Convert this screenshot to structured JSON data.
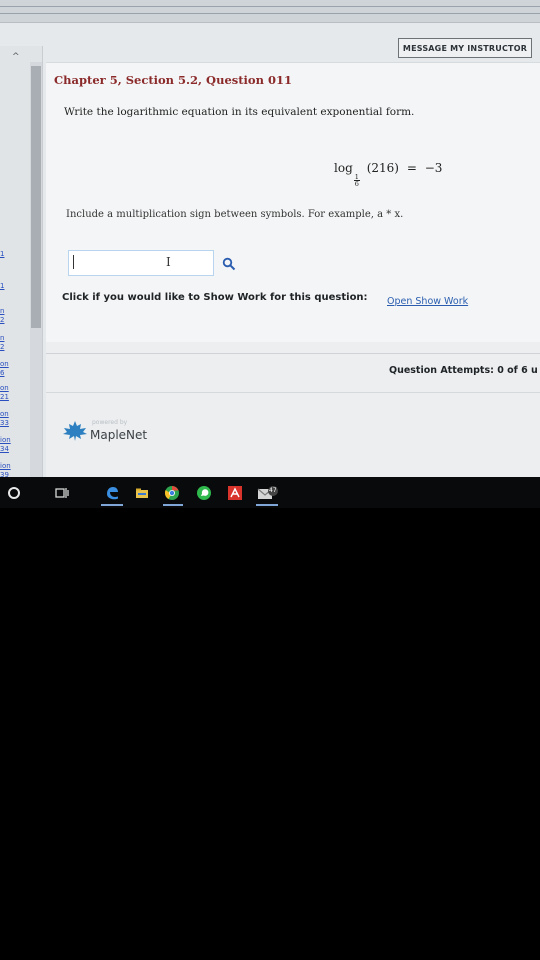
{
  "header": {
    "message_button": "MESSAGE MY INSTRUCTOR"
  },
  "sidebar": {
    "links": [
      "1",
      "1",
      "n",
      "2",
      "n",
      "2",
      "on",
      "6",
      "on",
      "21",
      "on",
      "33",
      "ion",
      "34",
      "ion",
      "39"
    ]
  },
  "question": {
    "heading": "Chapter 5, Section 5.2, Question 011",
    "instruction": "Write the logarithmic equation in its equivalent exponential form.",
    "equation": {
      "log": "log",
      "base_numerator": "1",
      "base_denominator": "6",
      "argument": "(216)",
      "equals": "=",
      "result": "−3"
    },
    "hint": "Include a multiplication sign between symbols. For example, a * x.",
    "answer": {
      "value": "",
      "placeholder": ""
    },
    "show_work": {
      "prompt": "Click if you would like to Show Work for this question:",
      "link": "Open Show Work"
    },
    "attempts": "Question Attempts: 0 of 6 u"
  },
  "footer": {
    "powered_by": "powered by",
    "brand": "MapleNet"
  },
  "taskbar": {
    "icons": [
      "cortana-icon",
      "task-view-icon",
      "edge-icon",
      "file-explorer-icon",
      "chrome-icon",
      "whatsapp-icon",
      "acrobat-icon",
      "mail-icon"
    ],
    "badge": "47"
  },
  "colors": {
    "heading": "#8b2a2a",
    "link": "#2a5db0",
    "accent_border": "#b9d4ef",
    "taskbar": "#080a0c"
  }
}
